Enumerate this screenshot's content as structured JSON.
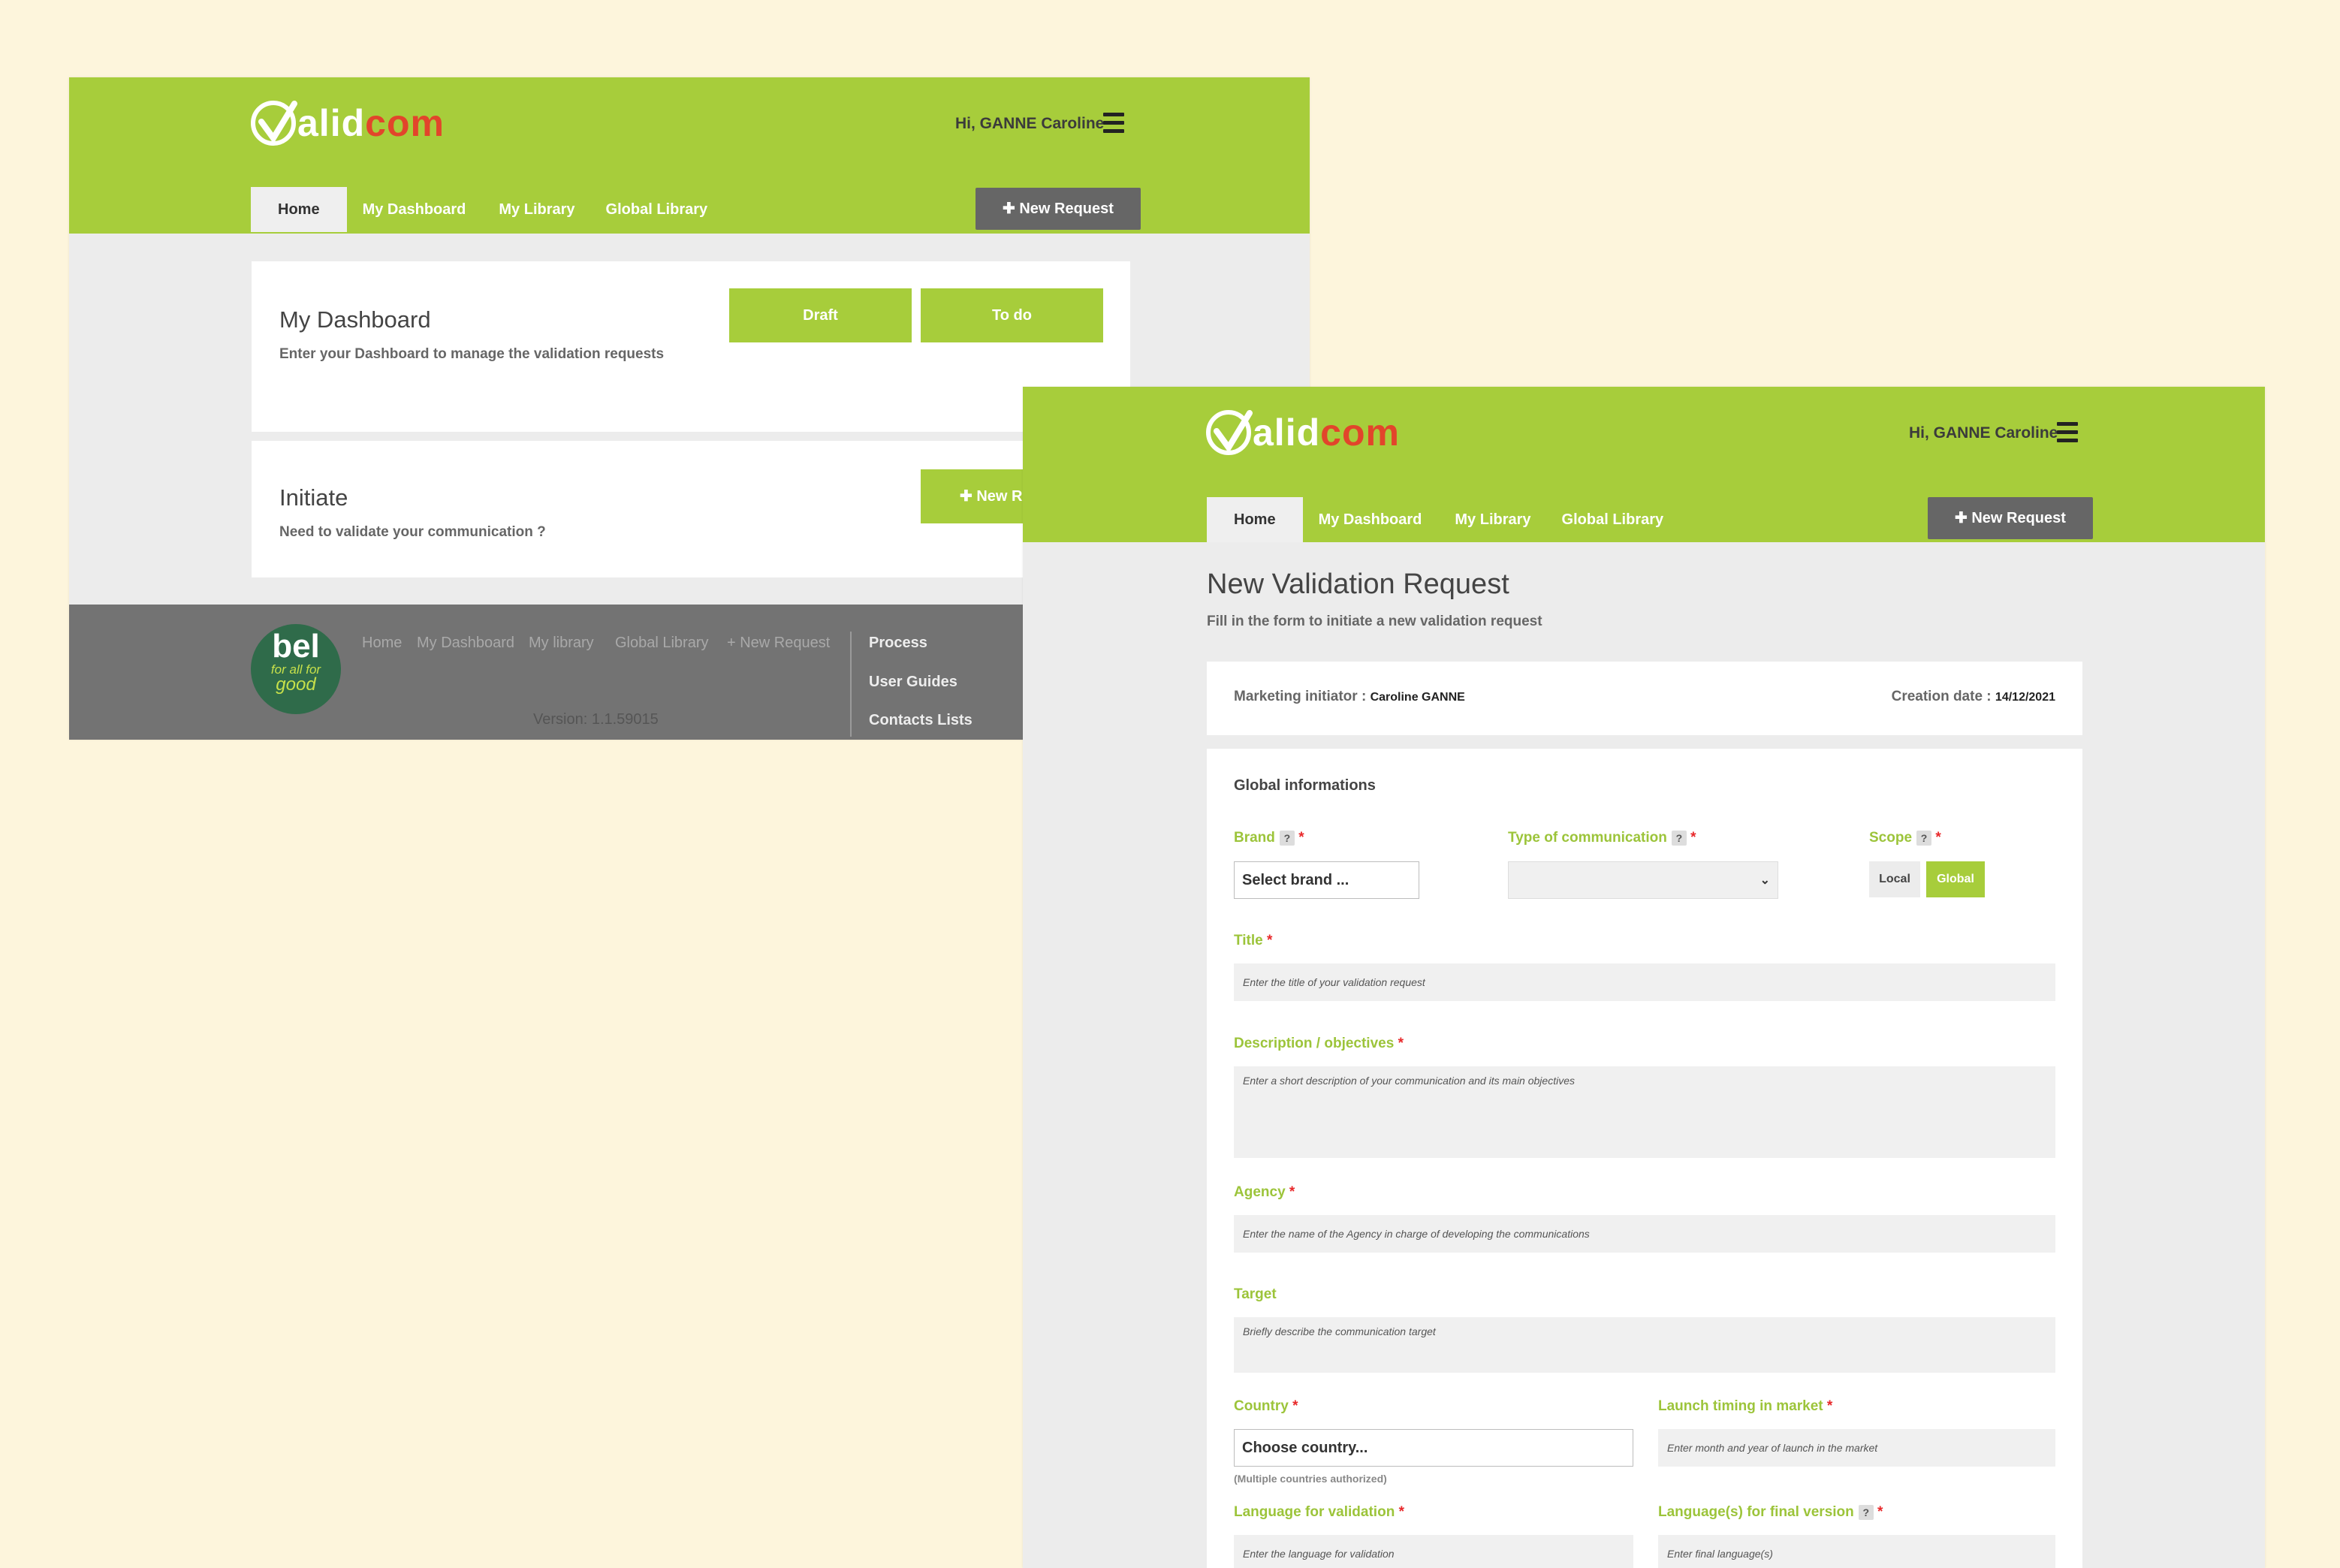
{
  "brand": {
    "logo_a": "alid",
    "logo_c": "com",
    "logo_v": "V"
  },
  "header": {
    "greeting": "Hi, GANNE Caroline"
  },
  "nav": {
    "home": "Home",
    "dashboard": "My Dashboard",
    "library": "My Library",
    "global": "Global Library",
    "new_request": "New Request"
  },
  "home": {
    "dashboard_title": "My Dashboard",
    "dashboard_sub": "Enter your Dashboard to manage the validation requests",
    "draft": "Draft",
    "todo": "To do",
    "initiate_title": "Initiate",
    "initiate_sub": "Need to validate your communication ?",
    "initiate_btn": "New Re"
  },
  "footer": {
    "bel_logo": "bel",
    "bel_tag1": "for all for",
    "bel_tag2": "good",
    "links": [
      "Home",
      "My Dashboard",
      "My library",
      "Global Library",
      "+ New Request"
    ],
    "right_links": [
      "Process",
      "User Guides",
      "Contacts Lists"
    ],
    "version": "Version: 1.1.59015"
  },
  "form": {
    "title": "New Validation Request",
    "subtitle": "Fill in the form to initiate a new validation request",
    "initiator_label": "Marketing initiator :",
    "initiator_value": "Caroline GANNE",
    "creation_label": "Creation date :",
    "creation_value": "14/12/2021",
    "section": "Global informations",
    "brand_label": "Brand",
    "brand_value": "Select brand ...",
    "type_label": "Type of communication",
    "scope_label": "Scope",
    "scope_local": "Local",
    "scope_global": "Global",
    "title_label": "Title",
    "title_ph": "Enter the title of your validation request",
    "desc_label": "Description / objectives",
    "desc_ph": "Enter a short description of your communication and its main objectives",
    "agency_label": "Agency",
    "agency_ph": "Enter the name of the Agency in charge of developing the communications",
    "target_label": "Target",
    "target_ph": "Briefly describe the communication target",
    "country_label": "Country",
    "country_value": "Choose country...",
    "country_note": "(Multiple countries authorized)",
    "launch_label": "Launch timing in market",
    "launch_ph": "Enter month and year of launch in the market",
    "langval_label": "Language for validation",
    "langval_ph": "Enter the language for validation",
    "langfinal_label": "Language(s) for final version",
    "langfinal_ph": "Enter final language(s)",
    "help": "?",
    "required": "*"
  }
}
